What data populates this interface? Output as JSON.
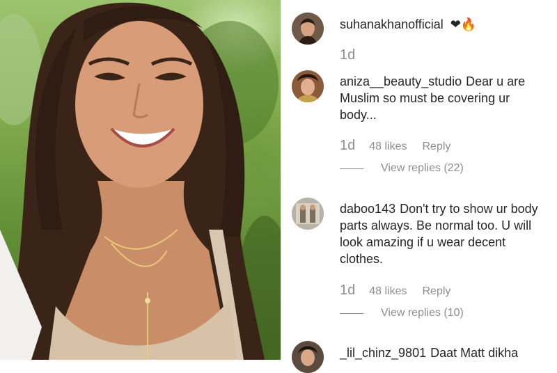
{
  "comments": [
    {
      "username": "suhanakhanofficial",
      "text": "",
      "emojis": "❤🔥",
      "age": "1d",
      "likes": "",
      "reply": "",
      "view_replies": ""
    },
    {
      "username": "aniza__beauty_studio",
      "text": "Dear u are Muslim so must be covering ur body...",
      "age": "1d",
      "likes": "48 likes",
      "reply": "Reply",
      "view_replies": "View replies (22)"
    },
    {
      "username": "daboo143",
      "text": "Don't try to show ur body parts always. Be normal too. U will look amazing if u wear decent clothes.",
      "age": "1d",
      "likes": "48 likes",
      "reply": "Reply",
      "view_replies": "View replies (10)"
    },
    {
      "username": "_lil_chinz_9801",
      "text": "Daat Matt dikha"
    }
  ],
  "colors": {
    "text": "#262626",
    "muted": "#8e8e8e",
    "heart": "#ed4956"
  }
}
